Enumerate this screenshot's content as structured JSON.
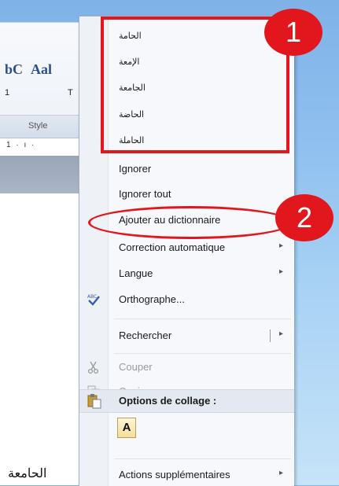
{
  "background": {
    "style_preview": [
      "bC",
      "Aal"
    ],
    "style_sub": [
      "1",
      "T"
    ],
    "style_group_label": "Style",
    "ruler_text": "1 · ı ·",
    "doc_text": "الحامعة"
  },
  "menu": {
    "suggestions": [
      "الحامة",
      "الإمعة",
      "الجامعة",
      "الحاضة",
      "الحاملة"
    ],
    "items": [
      {
        "label": "Ignorer",
        "disabled": false
      },
      {
        "label": "Ignorer tout",
        "disabled": false
      },
      {
        "label": "Ajouter au dictionnaire",
        "disabled": false
      },
      {
        "label": "Correction automatique",
        "disabled": false,
        "submenu": true
      },
      {
        "label": "Langue",
        "disabled": false,
        "submenu": true
      },
      {
        "label": "Orthographe...",
        "disabled": false
      },
      {
        "label": "Rechercher",
        "disabled": false,
        "submenu": true
      },
      {
        "label": "Couper",
        "disabled": true
      },
      {
        "label": "Copier",
        "disabled": true
      }
    ],
    "paste_header": "Options de collage :",
    "paste_option": "A",
    "more_actions": "Actions supplémentaires",
    "submenu_arrow": "▸"
  },
  "annotations": {
    "badge1": "1",
    "badge2": "2",
    "color": "#e2161d"
  },
  "icons": {
    "spelling": "spelling-check-icon",
    "cut": "scissors-icon",
    "copy": "copy-icon",
    "paste": "paste-icon"
  }
}
